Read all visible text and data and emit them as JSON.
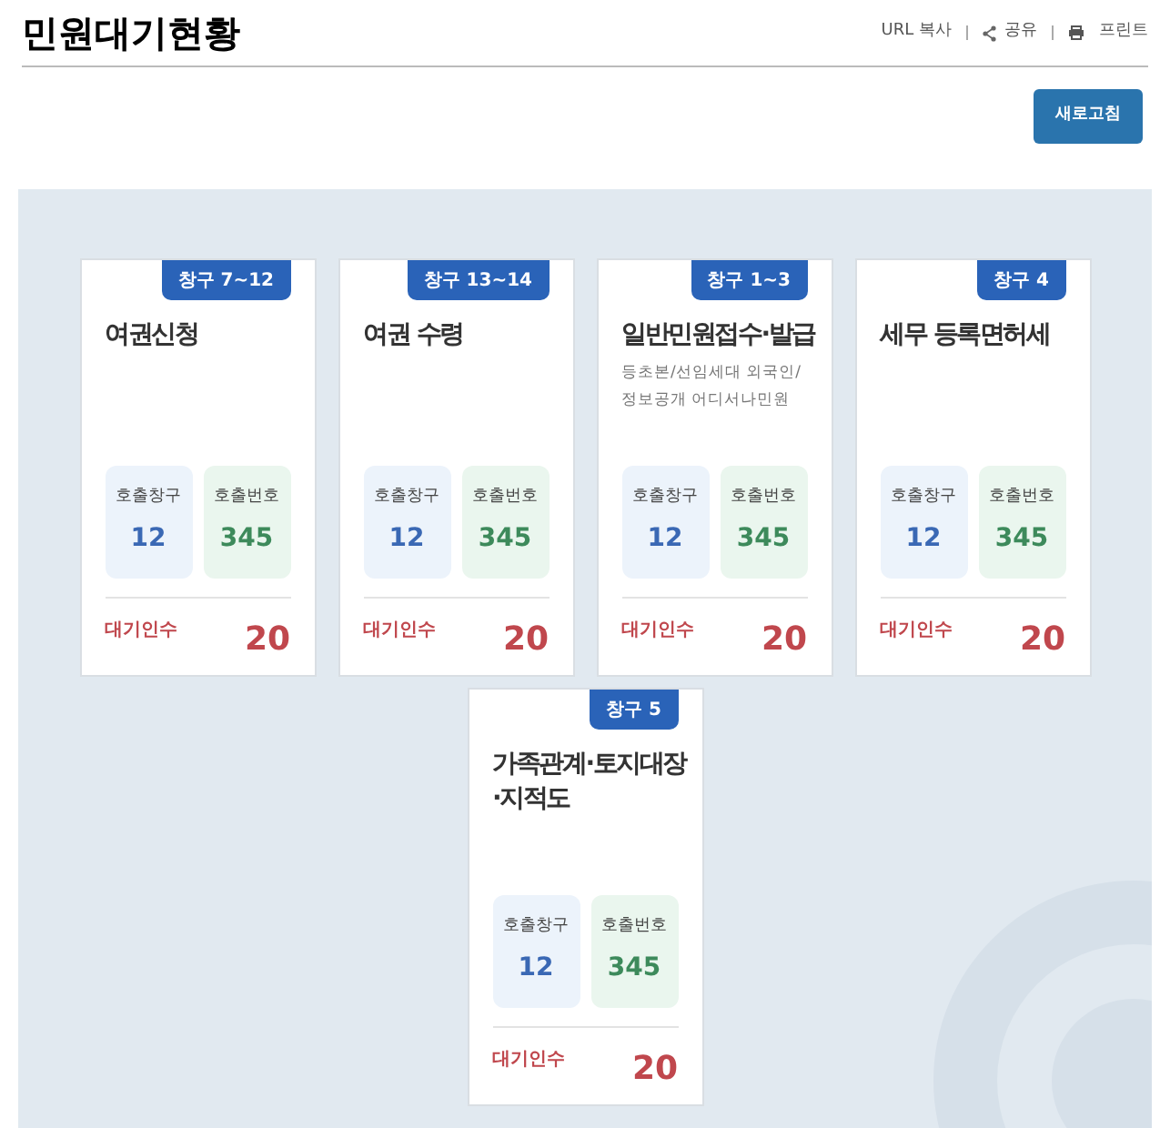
{
  "page_title": "민원대기현황",
  "header_actions": [
    {
      "kind": "text",
      "label": "URL 복사"
    },
    {
      "kind": "share",
      "label": "공유"
    },
    {
      "kind": "print",
      "label": "프린트"
    }
  ],
  "refresh_button": "새로고침",
  "counters": [
    {
      "window": "창구 7~12",
      "title": "여권신청",
      "call_window_label": "호출창구",
      "call_window": "12",
      "call_number_label": "호출번호",
      "call_number": "345",
      "waiting_label": "대기인수",
      "waiting": "20"
    },
    {
      "window": "창구 13~14",
      "title": "여권 수령",
      "call_window_label": "호출창구",
      "call_window": "12",
      "call_number_label": "호출번호",
      "call_number": "345",
      "waiting_label": "대기인수",
      "waiting": "20"
    },
    {
      "window": "창구 1~3",
      "title": "일반민원접수·발급",
      "description": "등초본/선임세대 외국인/ 정보공개 어디서나민원",
      "call_window_label": "호출창구",
      "call_window": "12",
      "call_number_label": "호출번호",
      "call_number": "345",
      "waiting_label": "대기인수",
      "waiting": "20"
    },
    {
      "window": "창구 4",
      "title": "세무 등록면허세",
      "call_window_label": "호출창구",
      "call_window": "12",
      "call_number_label": "호출번호",
      "call_number": "345",
      "waiting_label": "대기인수",
      "waiting": "20"
    },
    {
      "window": "창구 5",
      "title": "가족관계·토지대장·지적도",
      "call_window_label": "호출창구",
      "call_window": "12",
      "call_number_label": "호출번호",
      "call_number": "345",
      "waiting_label": "대기인수",
      "waiting": "20"
    }
  ]
}
